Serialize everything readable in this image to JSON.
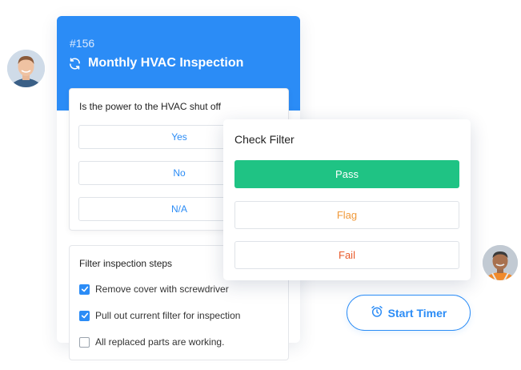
{
  "work_order": {
    "number": "#156",
    "title": "Monthly HVAC Inspection",
    "header_color": "#2b8cf6"
  },
  "power_question": {
    "label": "Is the power to the HVAC shut off",
    "options": [
      "Yes",
      "No",
      "N/A"
    ]
  },
  "filter_steps": {
    "title": "Filter inspection steps",
    "items": [
      {
        "label": "Remove cover with screwdriver",
        "checked": true
      },
      {
        "label": "Pull out current filter for inspection",
        "checked": true
      },
      {
        "label": "All replaced parts are working.",
        "checked": false
      }
    ]
  },
  "check_filter": {
    "title": "Check Filter",
    "pass_label": "Pass",
    "flag_label": "Flag",
    "fail_label": "Fail",
    "colors": {
      "pass": "#1fc384",
      "flag": "#f0993a",
      "fail": "#e85a2a"
    }
  },
  "timer": {
    "label": "Start Timer",
    "icon": "alarm-clock-icon"
  },
  "avatars": [
    {
      "icon": "user-avatar"
    },
    {
      "icon": "user-avatar"
    }
  ]
}
